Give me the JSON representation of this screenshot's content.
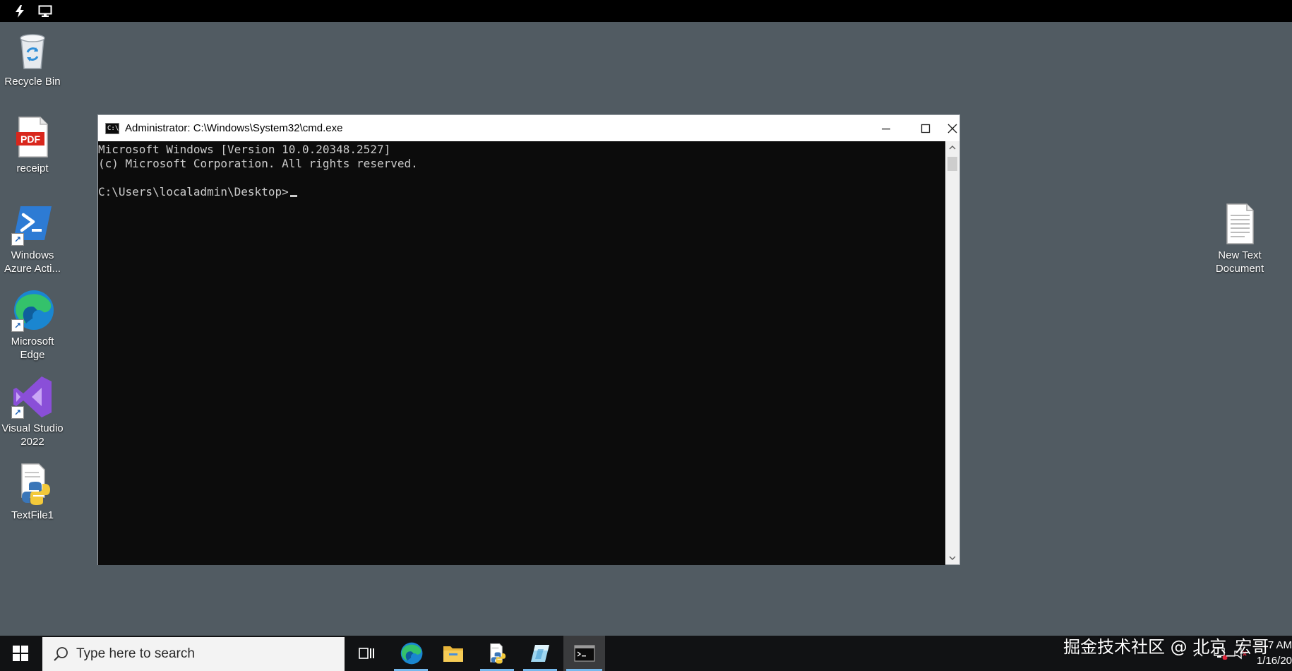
{
  "topbar": {
    "icons": [
      "lightning-icon",
      "monitor-icon"
    ]
  },
  "desktop": {
    "icons": [
      {
        "label": "Recycle Bin",
        "icon": "recycle-bin-icon"
      },
      {
        "label": "receipt",
        "icon": "pdf-file-icon",
        "badge": "PDF"
      },
      {
        "label": "Windows\nAzure Acti...",
        "icon": "powershell-icon"
      },
      {
        "label": "Microsoft\nEdge",
        "icon": "edge-icon"
      },
      {
        "label": "Visual Studio\n2022",
        "icon": "visual-studio-icon"
      },
      {
        "label": "TextFile1",
        "icon": "python-file-icon"
      },
      {
        "label": "New Text\nDocument",
        "icon": "text-document-icon"
      }
    ]
  },
  "cmd_window": {
    "title": "Administrator: C:\\Windows\\System32\\cmd.exe",
    "icon_text": "C:\\",
    "lines": [
      "Microsoft Windows [Version 10.0.20348.2527]",
      "(c) Microsoft Corporation. All rights reserved.",
      "",
      "C:\\Users\\localadmin\\Desktop>"
    ],
    "controls": [
      "minimize",
      "maximize",
      "close"
    ]
  },
  "taskbar": {
    "search_placeholder": "Type here to search",
    "apps": [
      "task-view",
      "edge",
      "file-explorer",
      "python-editor",
      "azure-tool",
      "command-prompt"
    ],
    "watermark": "掘金技术社区 @ 北京_宏哥",
    "clock_time": "7 AM",
    "clock_date": "1/16/20"
  },
  "colors": {
    "desktop_bg": "#515b62",
    "taskbar_bg": "#111214",
    "console_bg": "#0c0c0c",
    "console_fg": "#cccccc",
    "accent": "#76b9ed"
  }
}
